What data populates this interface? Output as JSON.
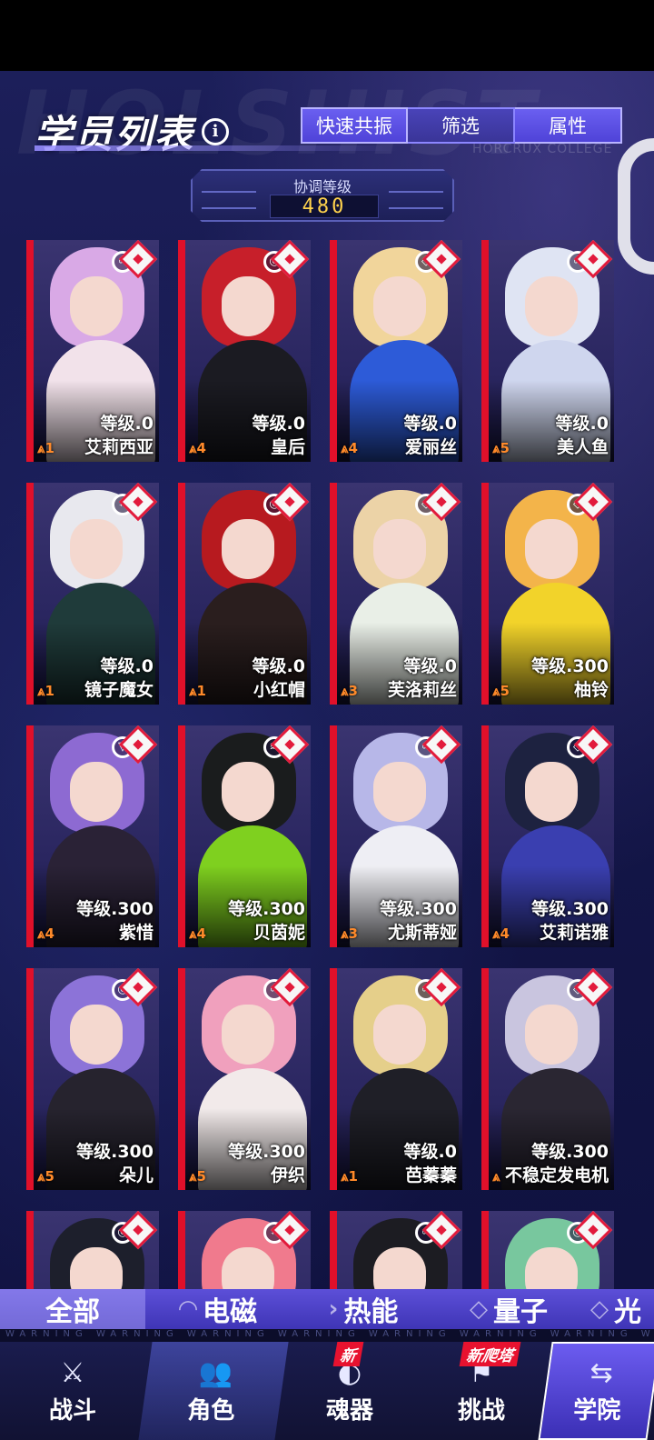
{
  "header": {
    "title": "学员列表",
    "info_glyph": "i",
    "bg_word": "HOLSHIST",
    "bg_subtitle": "HORCRUX COLLEGE",
    "buttons": [
      "快速共振",
      "筛选",
      "属性"
    ]
  },
  "sync_panel": {
    "label": "协调等级",
    "value": "480"
  },
  "characters": [
    {
      "name": "艾莉西亚",
      "level": "等级.0",
      "rank": "1",
      "hair": "#d9a9e6",
      "body": "#f2e2ea",
      "element": "∞"
    },
    {
      "name": "皇后",
      "level": "等级.0",
      "rank": "4",
      "hair": "#c71f2a",
      "body": "#1b1b22",
      "element": "◎"
    },
    {
      "name": "爱丽丝",
      "level": "等级.0",
      "rank": "4",
      "hair": "#f1d59b",
      "body": "#2d5bd8",
      "element": "◇"
    },
    {
      "name": "美人鱼",
      "level": "等级.0",
      "rank": "5",
      "hair": "#dfe4f3",
      "body": "#cfd6ee",
      "element": "∞"
    },
    {
      "name": "镜子魔女",
      "level": "等级.0",
      "rank": "1",
      "hair": "#e8e8ee",
      "body": "#1f3b3a",
      "element": "⌗"
    },
    {
      "name": "小红帽",
      "level": "等级.0",
      "rank": "1",
      "hair": "#b71a1f",
      "body": "#2a1e1e",
      "element": "◎"
    },
    {
      "name": "芙洛莉丝",
      "level": "等级.0",
      "rank": "3",
      "hair": "#ecd3a7",
      "body": "#e9efe7",
      "element": "◇"
    },
    {
      "name": "柚铃",
      "level": "等级.300",
      "rank": "5",
      "hair": "#f3b44a",
      "body": "#f2d32a",
      "element": "◇"
    },
    {
      "name": "紫惜",
      "level": "等级.300",
      "rank": "4",
      "hair": "#8d6ad2",
      "body": "#2a2236",
      "element": "▽"
    },
    {
      "name": "贝茵妮",
      "level": "等级.300",
      "rank": "4",
      "hair": "#1a1c1d",
      "body": "#7fd01f",
      "element": "≋"
    },
    {
      "name": "尤斯蒂娅",
      "level": "等级.300",
      "rank": "3",
      "hair": "#b7b7e8",
      "body": "#eeeef4",
      "element": "∞"
    },
    {
      "name": "艾莉诺雅",
      "level": "等级.300",
      "rank": "4",
      "hair": "#1d2240",
      "body": "#3a3fb0",
      "element": "◇"
    },
    {
      "name": "朵儿",
      "level": "等级.300",
      "rank": "5",
      "hair": "#8c73d8",
      "body": "#26232e",
      "element": "◎"
    },
    {
      "name": "伊织",
      "level": "等级.300",
      "rank": "5",
      "hair": "#f0a0bd",
      "body": "#f2eaea",
      "element": "∞"
    },
    {
      "name": "芭蓁蓁",
      "level": "等级.0",
      "rank": "1",
      "hair": "#e5cf8a",
      "body": "#1f1f27",
      "element": "∞"
    },
    {
      "name": "不稳定发电机",
      "level": "等级.300",
      "rank": "",
      "hair": "#c9c5df",
      "body": "#2a2632",
      "element": "◇"
    },
    {
      "name": "",
      "level": "",
      "rank": "",
      "hair": "#1d1f2c",
      "body": "#2d2c46",
      "element": "◎"
    },
    {
      "name": "",
      "level": "",
      "rank": "",
      "hair": "#f07a8d",
      "body": "#3a3580",
      "element": "⌗"
    },
    {
      "name": "",
      "level": "",
      "rank": "",
      "hair": "#1c1c22",
      "body": "#3a2c3a",
      "element": "∞"
    },
    {
      "name": "",
      "level": "",
      "rank": "",
      "hair": "#78c79e",
      "body": "#3c3a78",
      "element": "◎"
    }
  ],
  "filters": [
    "全部",
    "电磁",
    "热能",
    "量子",
    "光"
  ],
  "warning_text": "WARNING WARNING WARNING WARNING WARNING WARNING WARNING WARNING WARNING",
  "nav": [
    {
      "label": "战斗",
      "icon": "⚔",
      "new": ""
    },
    {
      "label": "角色",
      "icon": "👥",
      "new": ""
    },
    {
      "label": "魂器",
      "icon": "◐",
      "new": "新"
    },
    {
      "label": "挑战",
      "icon": "⚑",
      "new": "新爬塔"
    },
    {
      "label": "学院",
      "icon": "⇆",
      "new": ""
    }
  ]
}
